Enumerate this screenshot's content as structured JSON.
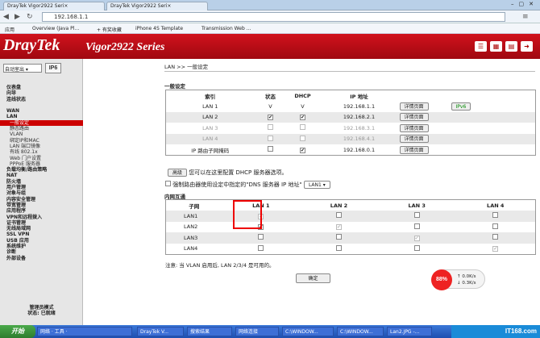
{
  "browser": {
    "tabs": [
      "DrayTek Vigor2922 Seri×",
      "DrayTek Vigor2922 Seri×"
    ],
    "address": "192.168.1.1",
    "bookmarks": [
      "应用",
      "Overview (Java Pl…",
      "+ 有奖收藏",
      "iPhone 4S Template",
      "Transmission Web …"
    ]
  },
  "header": {
    "logo": "DrayTek",
    "model": "Vigor2922 Series",
    "icons": [
      "sliders-icon",
      "grid-icon",
      "save-icon",
      "logout-icon"
    ]
  },
  "sidebar": {
    "mode_select": "自动室出",
    "ipv6_label": "IP6",
    "items": [
      {
        "label": "仪表盘",
        "sub": false
      },
      {
        "label": "向导",
        "sub": false
      },
      {
        "label": "连线状态",
        "sub": false
      },
      {
        "label": "",
        "sub": false
      },
      {
        "label": "WAN",
        "sub": false
      },
      {
        "label": "LAN",
        "sub": false
      },
      {
        "label": "一般设定",
        "sub": true,
        "active": true
      },
      {
        "label": "静态路由",
        "sub": true
      },
      {
        "label": "VLAN",
        "sub": true
      },
      {
        "label": "绑定IP和MAC",
        "sub": true
      },
      {
        "label": "LAN 端口镜像",
        "sub": true
      },
      {
        "label": "有线 802.1x",
        "sub": true
      },
      {
        "label": "Web 门户设置",
        "sub": true
      },
      {
        "label": "PPPoE 服务器",
        "sub": true
      },
      {
        "label": "负载均衡/路由策略",
        "sub": false
      },
      {
        "label": "NAT",
        "sub": false
      },
      {
        "label": "防火墙",
        "sub": false
      },
      {
        "label": "用户管理",
        "sub": false
      },
      {
        "label": "对象与组",
        "sub": false
      },
      {
        "label": "内容安全管理",
        "sub": false
      },
      {
        "label": "带宽管理",
        "sub": false
      },
      {
        "label": "应用程序",
        "sub": false
      },
      {
        "label": "VPN和远程拨入",
        "sub": false
      },
      {
        "label": "证书管理",
        "sub": false
      },
      {
        "label": "无线局域网",
        "sub": false
      },
      {
        "label": "SSL VPN",
        "sub": false
      },
      {
        "label": "USB 应用",
        "sub": false
      },
      {
        "label": "系统维护",
        "sub": false
      },
      {
        "label": "诊断",
        "sub": false
      },
      {
        "label": "外部设备",
        "sub": false
      }
    ],
    "footer_mode": "管理员模式",
    "footer_status": "状态: 已就绪"
  },
  "main": {
    "breadcrumb": "LAN >> 一般设定",
    "section1": "一般设定",
    "lan_headers": [
      "索引",
      "状态",
      "DHCP",
      "IP 地址",
      ""
    ],
    "lan_rows": [
      {
        "name": "LAN 1",
        "status": "V",
        "dhcp": "V",
        "ip": "192.168.1.1",
        "btn": "详情页面",
        "extra": "IPv6",
        "dis": false,
        "chk": false
      },
      {
        "name": "LAN 2",
        "status": "✔",
        "dhcp": "✔",
        "ip": "192.168.2.1",
        "btn": "详情页面",
        "extra": "",
        "dis": false,
        "chk": true
      },
      {
        "name": "LAN 3",
        "status": "",
        "dhcp": "",
        "ip": "192.168.3.1",
        "btn": "详情页面",
        "extra": "",
        "dis": true,
        "chk": true
      },
      {
        "name": "LAN 4",
        "status": "",
        "dhcp": "",
        "ip": "192.168.4.1",
        "btn": "详情页面",
        "extra": "",
        "dis": true,
        "chk": true
      },
      {
        "name": "IP 路由子网掩码",
        "status": "",
        "dhcp": "✔",
        "ip": "192.168.0.1",
        "btn": "详情页面",
        "extra": "",
        "dis": false,
        "chk": true
      }
    ],
    "advanced_btn": "高级",
    "advanced_text": "您可以在这里配置 DHCP 服务器选项。",
    "dns_text": "强制路由器使用设定中指定的\"DNS 服务器 IP 地址\"",
    "dns_select": "LAN1",
    "section2": "内网互通",
    "inter_headers": [
      "子网",
      "LAN 1",
      "LAN 2",
      "LAN 3",
      "LAN 4"
    ],
    "inter_rows": [
      {
        "name": "LAN1",
        "cells": [
          "✔",
          "",
          "",
          ""
        ]
      },
      {
        "name": "LAN2",
        "cells": [
          "✔",
          "✔",
          "",
          ""
        ]
      },
      {
        "name": "LAN3",
        "cells": [
          "",
          "",
          "✔",
          ""
        ]
      },
      {
        "name": "LAN4",
        "cells": [
          "",
          "",
          "",
          "✔"
        ]
      }
    ],
    "note": "注意: 当 VLAN 启用后, LAN 2/3/4 是可用的。",
    "ok_btn": "确定"
  },
  "speed": {
    "pct": "88%",
    "up": "0.0K/s",
    "down": "0.3K/s"
  },
  "taskbar": {
    "start": "开始",
    "items": [
      "网络 · 工具 ·",
      "DrayTek V...",
      "搜索结果",
      "网络连接",
      "C:\\WINDOW...",
      "C:\\WINDOW...",
      "Lan2.JPG -..."
    ],
    "tray": "IT168.com"
  }
}
